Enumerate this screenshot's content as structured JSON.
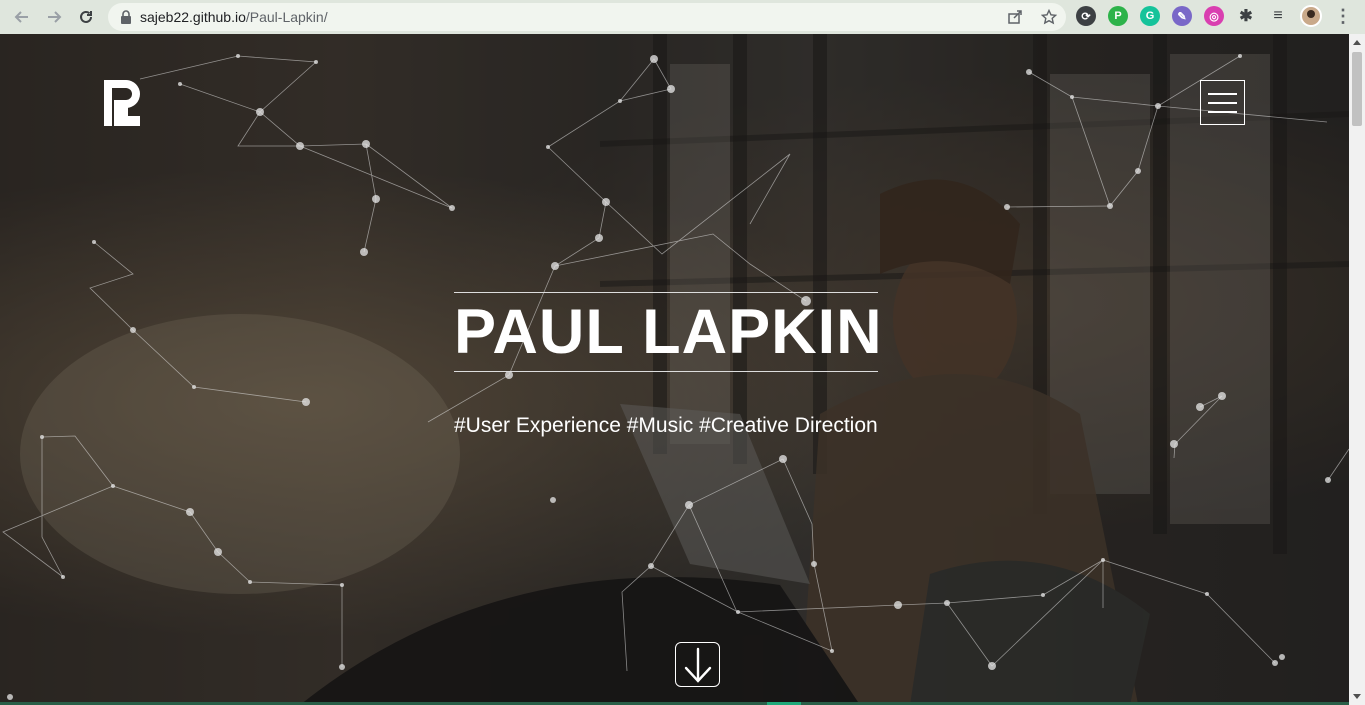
{
  "browser": {
    "url_host": "sajeb22.github.io",
    "url_path": "/Paul-Lapkin/",
    "back_icon": "arrow-left-icon",
    "forward_icon": "arrow-right-icon",
    "reload_icon": "reload-icon",
    "extensions": [
      {
        "name": "sync-extension-icon",
        "color": "#3c4043",
        "glyph": "⟳"
      },
      {
        "name": "pushbullet-extension-icon",
        "color": "#2db34a",
        "glyph": "P"
      },
      {
        "name": "grammarly-extension-icon",
        "color": "#15c39a",
        "glyph": "G"
      },
      {
        "name": "colorpicker-extension-icon",
        "color": "#7a68c8",
        "glyph": "✎"
      },
      {
        "name": "chrome-color-extension-icon",
        "color": "#d93fb0",
        "glyph": "◎"
      },
      {
        "name": "extensions-puzzle-icon",
        "color": "#5f6368",
        "glyph": "✱"
      },
      {
        "name": "reading-list-icon",
        "color": "#5f6368",
        "glyph": "≡"
      }
    ]
  },
  "hero": {
    "title": "PAUL LAPKIN",
    "tagline": "#User Experience #Music #Creative Direction",
    "logo_letter": "P"
  },
  "colors": {
    "accent": "#1fa97a",
    "text": "#ffffff"
  }
}
